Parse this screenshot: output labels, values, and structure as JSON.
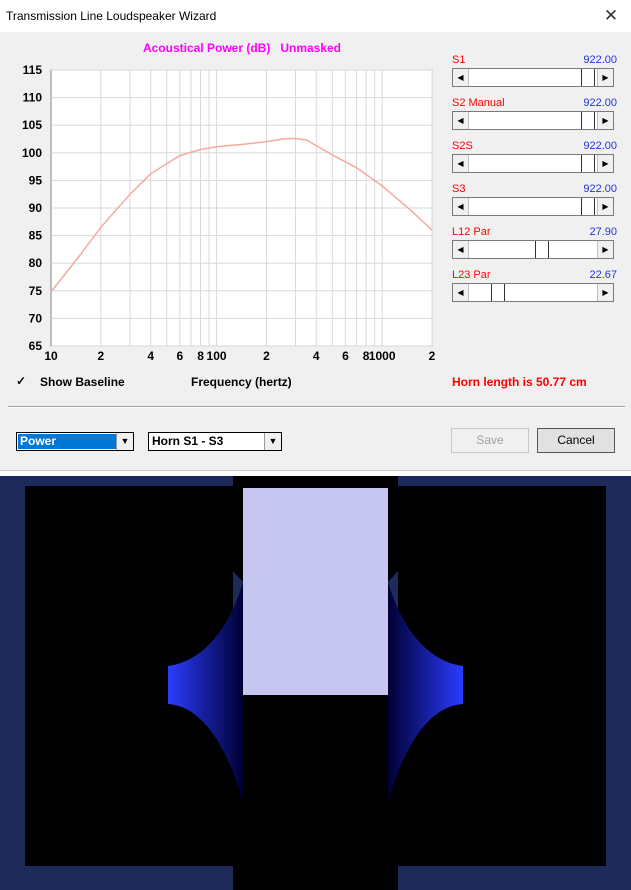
{
  "window": {
    "title": "Transmission Line Loudspeaker Wizard",
    "close_glyph": "✕"
  },
  "chart_data": {
    "type": "line",
    "title": "Acoustical Power (dB)   Unmasked",
    "xlabel": "Frequency (hertz)",
    "ylabel": "",
    "x_scale": "log",
    "xlim": [
      10,
      2000
    ],
    "ylim": [
      65,
      115
    ],
    "y_ticks": [
      115,
      110,
      105,
      100,
      95,
      90,
      85,
      80,
      75,
      70,
      65
    ],
    "x_ticks": [
      {
        "value": 10,
        "label": "10"
      },
      {
        "value": 20,
        "label": "2"
      },
      {
        "value": 40,
        "label": "4"
      },
      {
        "value": 60,
        "label": "6"
      },
      {
        "value": 80,
        "label": "8"
      },
      {
        "value": 100,
        "label": "100"
      },
      {
        "value": 200,
        "label": "2"
      },
      {
        "value": 400,
        "label": "4"
      },
      {
        "value": 600,
        "label": "6"
      },
      {
        "value": 800,
        "label": "8"
      },
      {
        "value": 1000,
        "label": "1000"
      },
      {
        "value": 2000,
        "label": "2"
      }
    ],
    "grid": true,
    "series": [
      {
        "name": "",
        "color": "#f4aaa0",
        "x": [
          10,
          15,
          20,
          30,
          40,
          60,
          80,
          100,
          150,
          200,
          250,
          300,
          350,
          400,
          500,
          700,
          1000,
          1500,
          2000
        ],
        "y": [
          74.8,
          81.5,
          86.5,
          92.5,
          96.2,
          99.5,
          100.6,
          101.1,
          101.6,
          102.0,
          102.5,
          102.6,
          102.3,
          101.3,
          99.6,
          97.3,
          94.0,
          89.5,
          86.0
        ]
      }
    ]
  },
  "sliders": [
    {
      "name": "S1",
      "value": "922.00",
      "position": 0.97
    },
    {
      "name": "S2 Manual",
      "value": "922.00",
      "position": 0.97
    },
    {
      "name": "S2S",
      "value": "922.00",
      "position": 0.97
    },
    {
      "name": "S3",
      "value": "922.00",
      "position": 0.97
    },
    {
      "name": "L12 Par",
      "value": "27.90",
      "position": 0.58
    },
    {
      "name": "L23 Par",
      "value": "22.67",
      "position": 0.2
    }
  ],
  "checkbox": {
    "label": "Show Baseline",
    "checked": true,
    "check_glyph": "✓"
  },
  "status": {
    "horn_length": "Horn length is 50.77 cm"
  },
  "controls": {
    "mode_select": "Power",
    "horn_select": "Horn S1 - S3",
    "save_label": "Save",
    "cancel_label": "Cancel",
    "dropdown_glyph": "▼"
  },
  "colors": {
    "enclosure": "#1e2a5a",
    "driver": "#c6c6f0",
    "horn_gradient_start": "#000033",
    "horn_gradient_end": "#2a3dff",
    "title_color": "#ff00ff"
  }
}
